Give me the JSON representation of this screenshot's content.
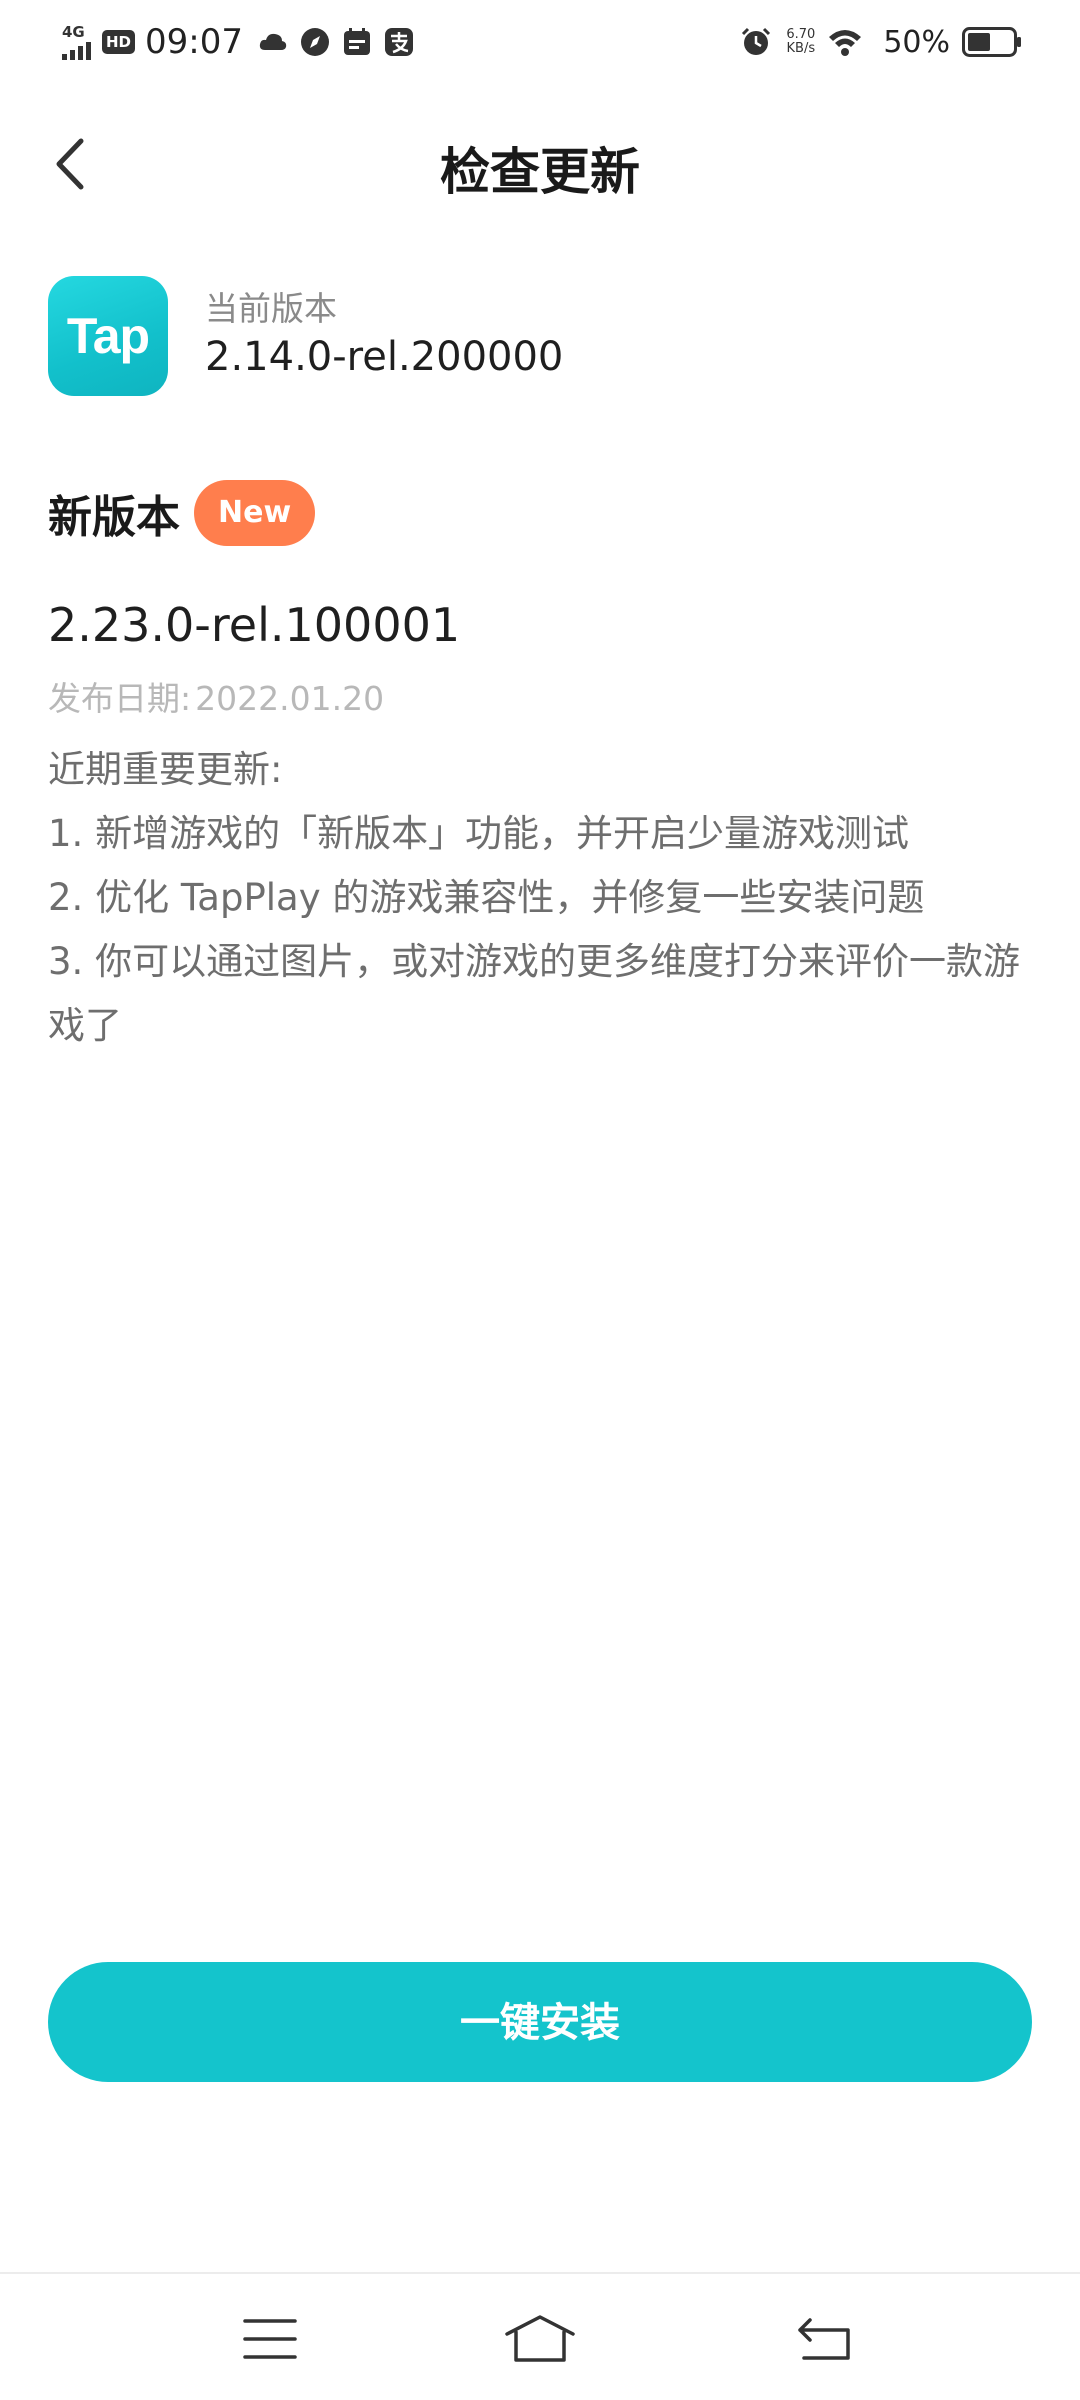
{
  "status_bar": {
    "network": "4G",
    "hd": "HD",
    "time": "09:07",
    "speed_value": "6.70",
    "speed_unit": "KB/s",
    "battery": "50%",
    "icons": [
      "signal-icon",
      "cloud-icon",
      "compass-icon",
      "calendar-icon",
      "alipay-icon",
      "alarm-icon",
      "wifi-icon",
      "battery-icon"
    ]
  },
  "header": {
    "title": "检查更新",
    "back_icon": "chevron-left-icon"
  },
  "current": {
    "app_icon_text": "Tap",
    "label": "当前版本",
    "version": "2.14.0-rel.200000"
  },
  "new_version": {
    "title": "新版本",
    "badge": "New",
    "version": "2.23.0-rel.100001",
    "date_label": "发布日期:",
    "date": "2022.01.20",
    "notes_title": "近期重要更新:",
    "notes": [
      "1. 新增游戏的「新版本」功能，并开启少量游戏测试",
      "2. 优化 TapPlay 的游戏兼容性，并修复一些安装问题",
      "3. 你可以通过图片，或对游戏的更多维度打分来评价一款游戏了"
    ]
  },
  "install": {
    "label": "一键安装"
  },
  "colors": {
    "accent": "#14c4cc",
    "badge": "#ff7e4d",
    "secondary_text": "#8a8a8a",
    "date_text": "#b8b8b8"
  }
}
